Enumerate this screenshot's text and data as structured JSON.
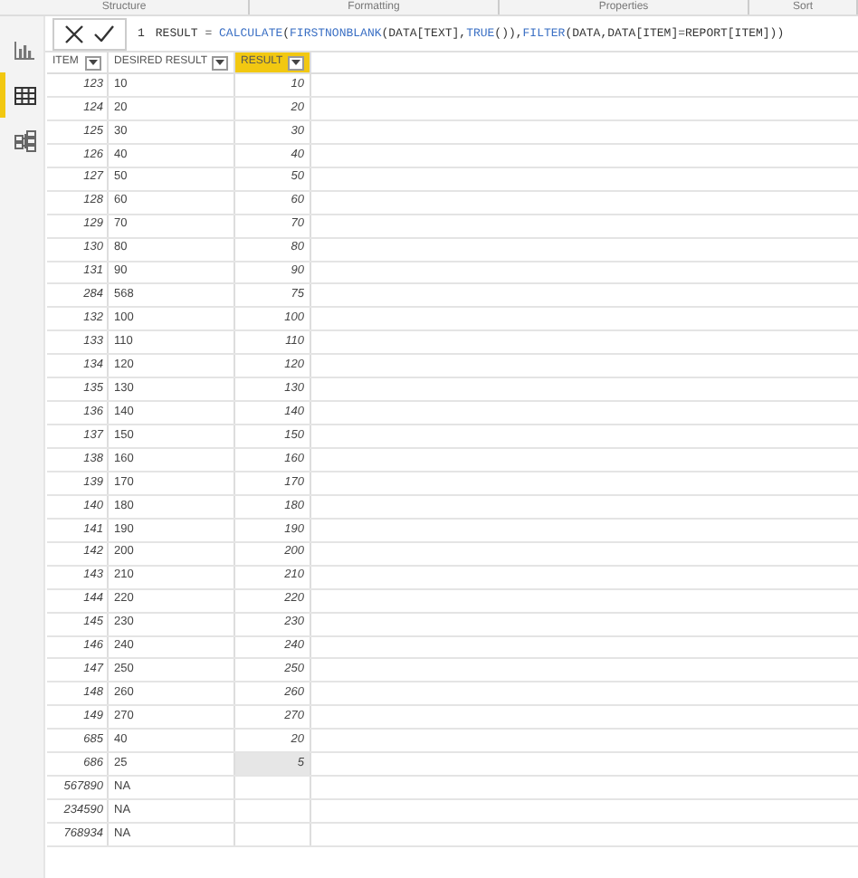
{
  "ribbon_groups": [
    "Structure",
    "Formatting",
    "Properties",
    "Sort"
  ],
  "formula_bar": {
    "line_number": "1",
    "tokens": [
      {
        "kind": "plain",
        "text": "RESULT = "
      },
      {
        "kind": "function",
        "text": "CALCULATE"
      },
      {
        "kind": "plain",
        "text": "("
      },
      {
        "kind": "function",
        "text": "FIRSTNONBLANK"
      },
      {
        "kind": "plain",
        "text": "(DATA[TEXT],"
      },
      {
        "kind": "function",
        "text": "TRUE"
      },
      {
        "kind": "plain",
        "text": "()),"
      },
      {
        "kind": "function",
        "text": "FILTER"
      },
      {
        "kind": "plain",
        "text": "(DATA,DATA[ITEM]=REPORT[ITEM]))"
      }
    ]
  },
  "sidebar": {
    "items": [
      {
        "kind": "report",
        "selected": false
      },
      {
        "kind": "data",
        "selected": true
      },
      {
        "kind": "model",
        "selected": false
      }
    ]
  },
  "table": {
    "columns": [
      {
        "label": "ITEM",
        "selected": false
      },
      {
        "label": "DESIRED RESULT",
        "selected": false
      },
      {
        "label": "RESULT",
        "selected": true
      }
    ],
    "rows": [
      {
        "item": "123",
        "desired": "10",
        "result": "10",
        "selected": false
      },
      {
        "item": "124",
        "desired": "20",
        "result": "20",
        "selected": false
      },
      {
        "item": "125",
        "desired": "30",
        "result": "30",
        "selected": false
      },
      {
        "item": "126",
        "desired": "40",
        "result": "40",
        "selected": false
      },
      {
        "item": "127",
        "desired": "50",
        "result": "50",
        "selected": false
      },
      {
        "item": "128",
        "desired": "60",
        "result": "60",
        "selected": false
      },
      {
        "item": "129",
        "desired": "70",
        "result": "70",
        "selected": false
      },
      {
        "item": "130",
        "desired": "80",
        "result": "80",
        "selected": false
      },
      {
        "item": "131",
        "desired": "90",
        "result": "90",
        "selected": false
      },
      {
        "item": "284",
        "desired": "568",
        "result": "75",
        "selected": false
      },
      {
        "item": "132",
        "desired": "100",
        "result": "100",
        "selected": false
      },
      {
        "item": "133",
        "desired": "110",
        "result": "110",
        "selected": false
      },
      {
        "item": "134",
        "desired": "120",
        "result": "120",
        "selected": false
      },
      {
        "item": "135",
        "desired": "130",
        "result": "130",
        "selected": false
      },
      {
        "item": "136",
        "desired": "140",
        "result": "140",
        "selected": false
      },
      {
        "item": "137",
        "desired": "150",
        "result": "150",
        "selected": false
      },
      {
        "item": "138",
        "desired": "160",
        "result": "160",
        "selected": false
      },
      {
        "item": "139",
        "desired": "170",
        "result": "170",
        "selected": false
      },
      {
        "item": "140",
        "desired": "180",
        "result": "180",
        "selected": false
      },
      {
        "item": "141",
        "desired": "190",
        "result": "190",
        "selected": false
      },
      {
        "item": "142",
        "desired": "200",
        "result": "200",
        "selected": false
      },
      {
        "item": "143",
        "desired": "210",
        "result": "210",
        "selected": false
      },
      {
        "item": "144",
        "desired": "220",
        "result": "220",
        "selected": false
      },
      {
        "item": "145",
        "desired": "230",
        "result": "230",
        "selected": false
      },
      {
        "item": "146",
        "desired": "240",
        "result": "240",
        "selected": false
      },
      {
        "item": "147",
        "desired": "250",
        "result": "250",
        "selected": false
      },
      {
        "item": "148",
        "desired": "260",
        "result": "260",
        "selected": false
      },
      {
        "item": "149",
        "desired": "270",
        "result": "270",
        "selected": false
      },
      {
        "item": "685",
        "desired": "40",
        "result": "20",
        "selected": false
      },
      {
        "item": "686",
        "desired": "25",
        "result": "5",
        "selected": true
      },
      {
        "item": "567890",
        "desired": "NA",
        "selected": false
      },
      {
        "item": "234590",
        "desired": "NA",
        "selected": false
      },
      {
        "item": "768934",
        "desired": "NA",
        "selected": false
      }
    ]
  }
}
